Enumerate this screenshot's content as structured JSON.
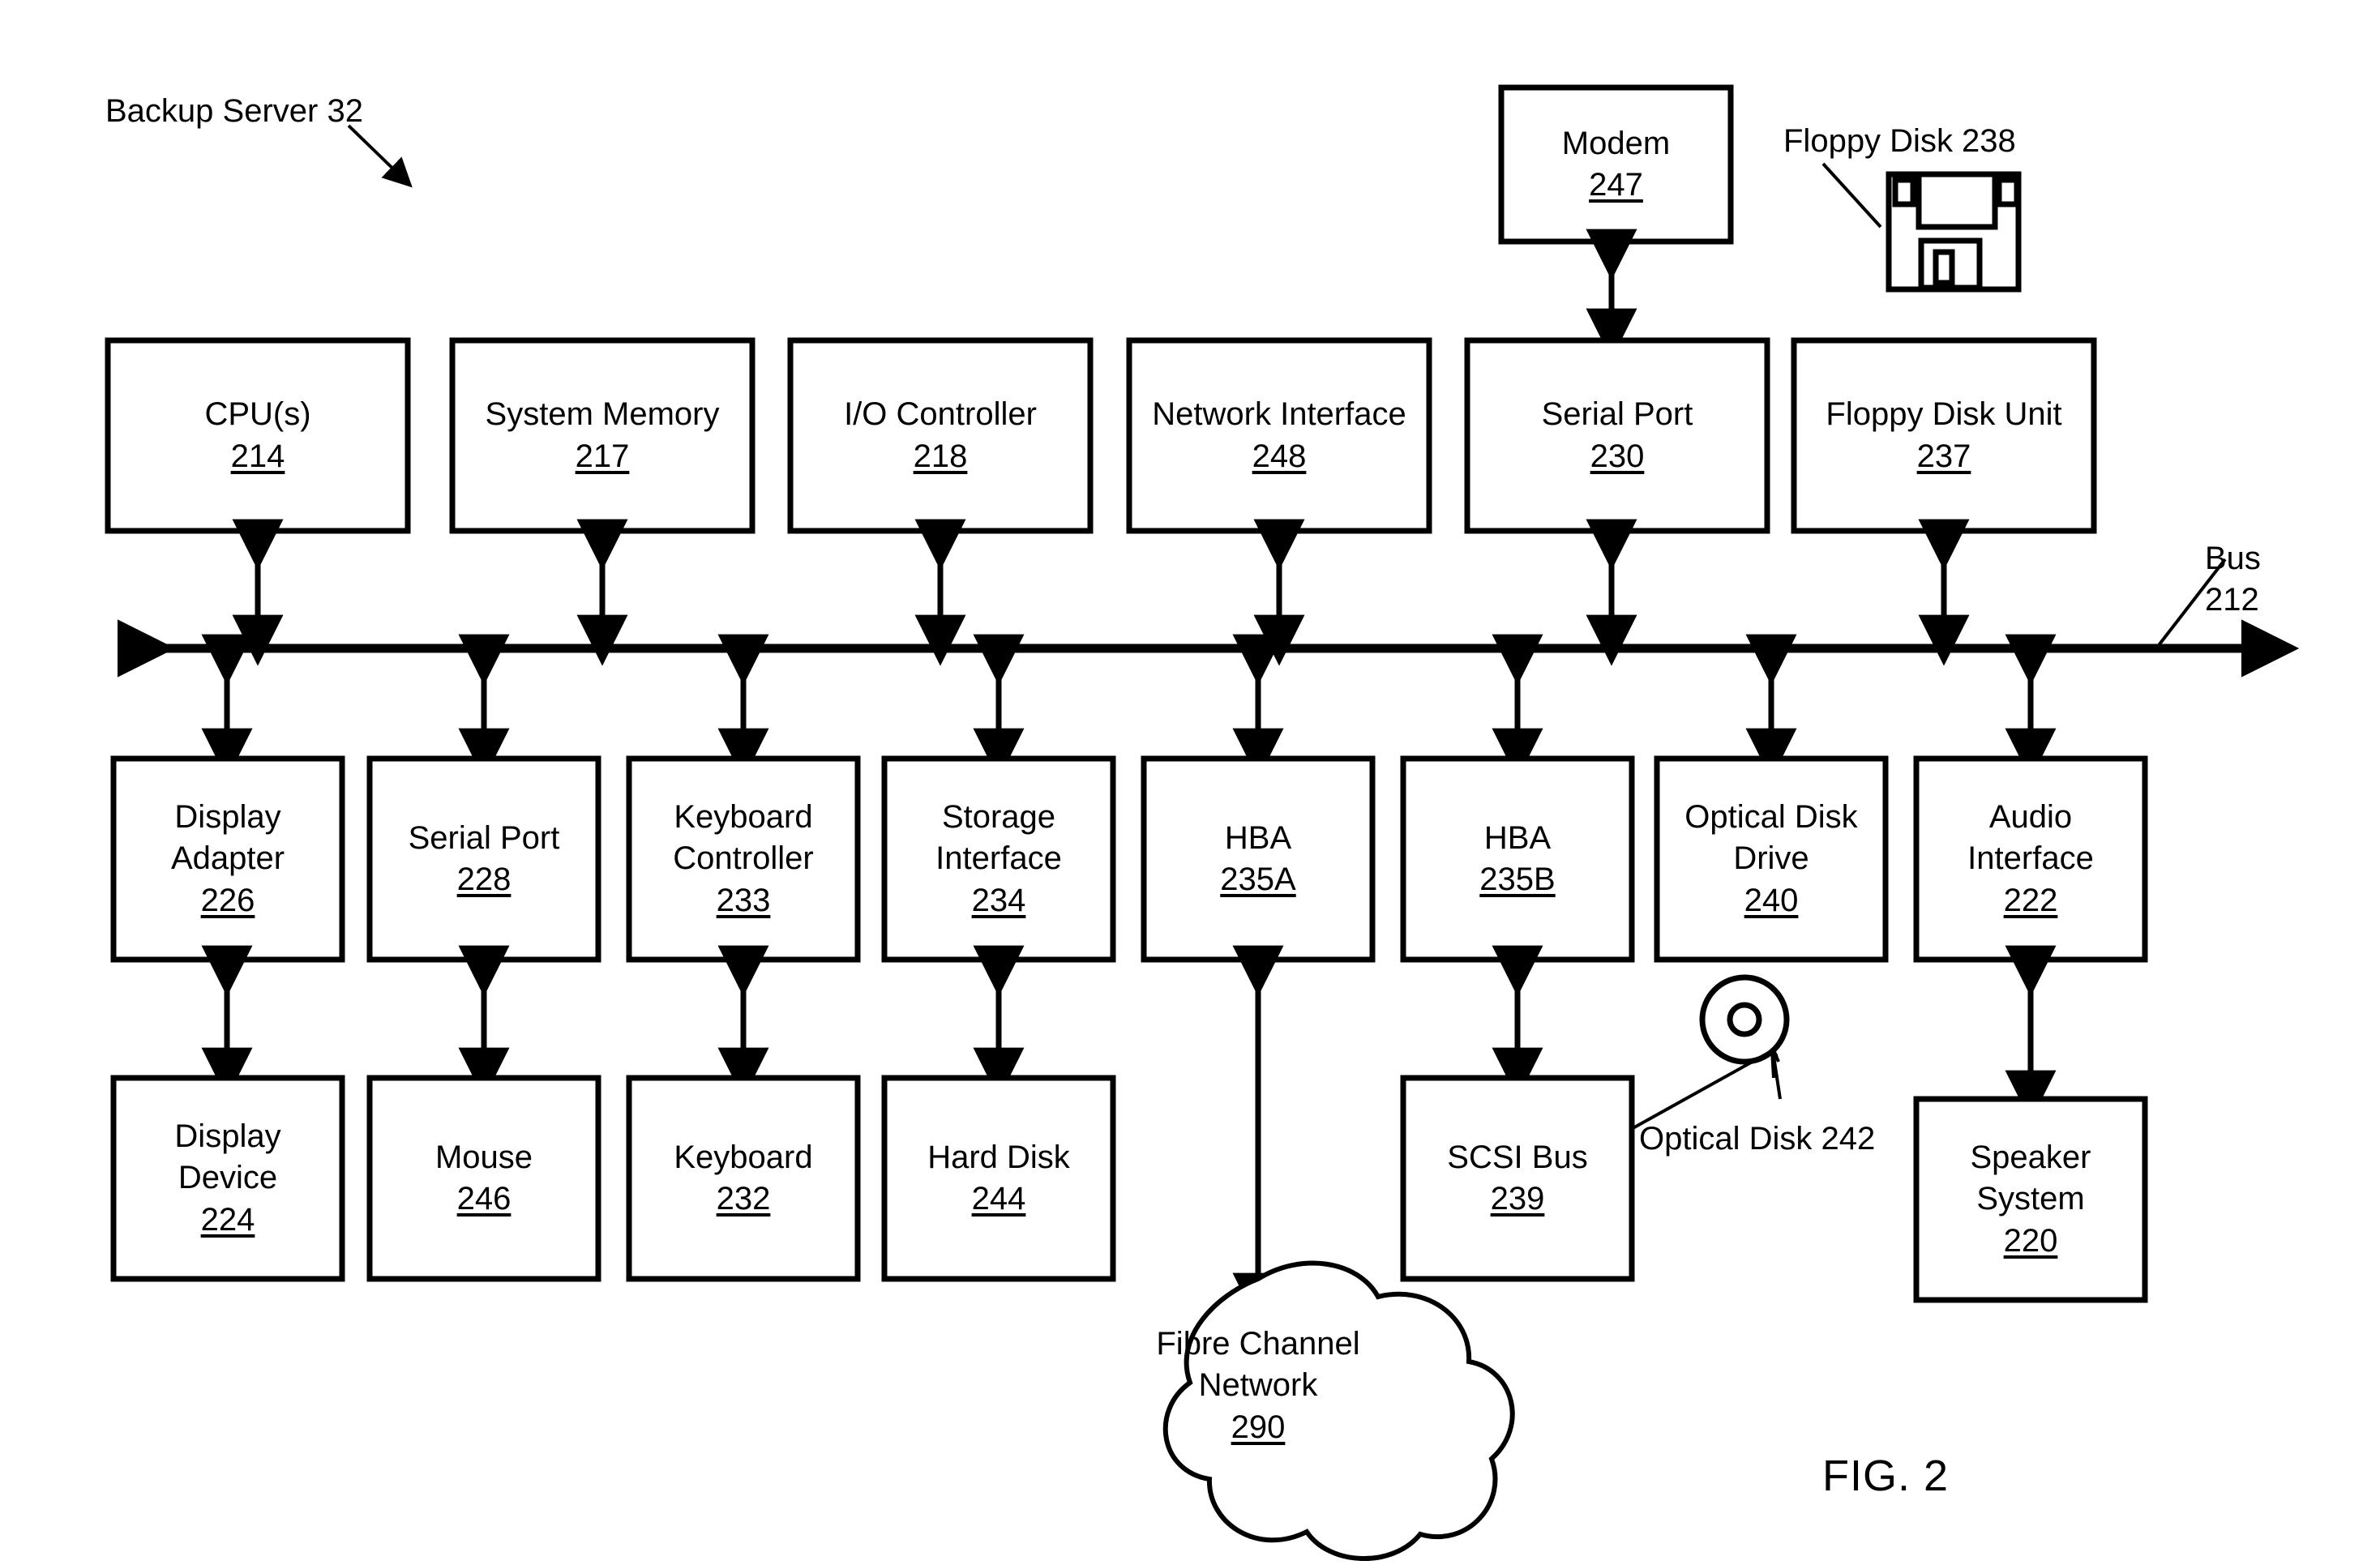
{
  "figure": {
    "caption": "FIG. 2",
    "title_label": "Backup Server 32",
    "bus_label_line1": "Bus",
    "bus_label_line2": "212"
  },
  "callouts": {
    "floppy_disk": "Floppy Disk 238",
    "optical_disk": "Optical Disk 242"
  },
  "top_peripheral": {
    "modem": {
      "name": "Modem",
      "num": "247"
    }
  },
  "row_top": [
    {
      "name": "CPU(s)",
      "num": "214"
    },
    {
      "name": "System Memory",
      "num": "217"
    },
    {
      "name": "I/O Controller",
      "num": "218"
    },
    {
      "name": "Network Interface",
      "num": "248"
    },
    {
      "name": "Serial Port",
      "num": "230"
    },
    {
      "name": "Floppy Disk Unit",
      "num": "237"
    }
  ],
  "row_middle": [
    {
      "name": "Display Adapter",
      "line1": "Display",
      "line2": "Adapter",
      "num": "226"
    },
    {
      "name": "Serial Port",
      "line1": "Serial Port",
      "line2": "",
      "num": "228"
    },
    {
      "name": "Keyboard Controller",
      "line1": "Keyboard",
      "line2": "Controller",
      "num": "233"
    },
    {
      "name": "Storage Interface",
      "line1": "Storage",
      "line2": "Interface",
      "num": "234"
    },
    {
      "name": "HBA 235A",
      "line1": "HBA",
      "line2": "",
      "num": "235A"
    },
    {
      "name": "HBA 235B",
      "line1": "HBA",
      "line2": "",
      "num": "235B"
    },
    {
      "name": "Optical Disk Drive",
      "line1": "Optical Disk",
      "line2": "Drive",
      "num": "240"
    },
    {
      "name": "Audio Interface",
      "line1": "Audio",
      "line2": "Interface",
      "num": "222"
    }
  ],
  "row_bottom": [
    {
      "name": "Display Device",
      "line1": "Display",
      "line2": "Device",
      "num": "224"
    },
    {
      "name": "Mouse",
      "line1": "Mouse",
      "line2": "",
      "num": "246"
    },
    {
      "name": "Keyboard",
      "line1": "Keyboard",
      "line2": "",
      "num": "232"
    },
    {
      "name": "Hard Disk",
      "line1": "Hard Disk",
      "line2": "",
      "num": "244"
    },
    {
      "name": "SCSI Bus",
      "line1": "SCSI Bus",
      "line2": "",
      "num": "239"
    },
    {
      "name": "Speaker System",
      "line1": "Speaker",
      "line2": "System",
      "num": "220"
    }
  ],
  "cloud": {
    "line1": "Fibre Channel",
    "line2": "Network",
    "num": "290"
  },
  "colors": {
    "ink": "#000000",
    "paper": "#ffffff"
  }
}
